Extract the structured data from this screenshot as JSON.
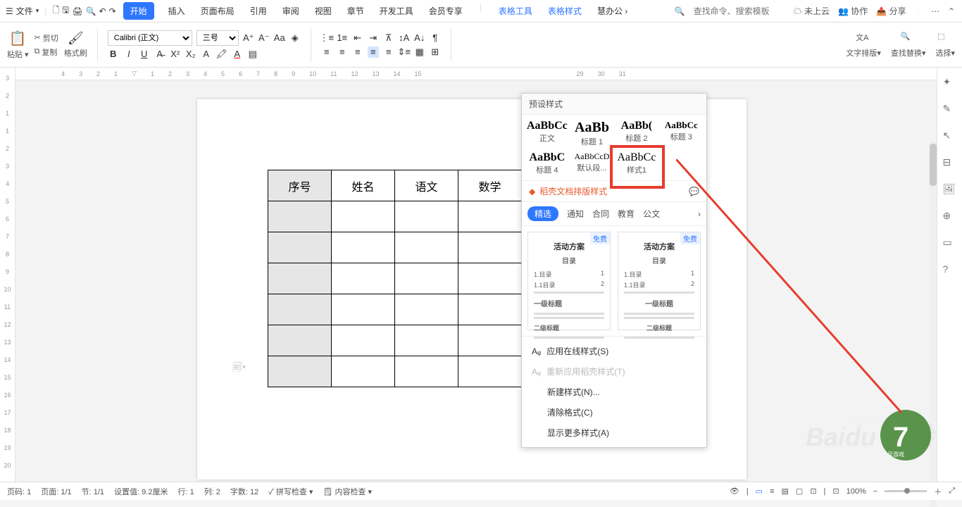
{
  "menu": {
    "file": "文件",
    "tabs": [
      "开始",
      "插入",
      "页面布局",
      "引用",
      "审阅",
      "视图",
      "章节",
      "开发工具",
      "会员专享"
    ],
    "extra": [
      "表格工具",
      "表格样式",
      "慧办公"
    ],
    "search_placeholder": "查找命令、搜索模板",
    "cloud": "未上云",
    "coop": "协作",
    "share": "分享"
  },
  "ribbon": {
    "paste": "粘贴",
    "cut": "剪切",
    "copy": "复制",
    "format_painter": "格式刷",
    "font": "Calibri (正文)",
    "size": "三号",
    "typeset": "文字排版",
    "find": "查找替换",
    "select": "选择"
  },
  "table": {
    "h1": "序号",
    "h2": "姓名",
    "h3": "语文",
    "h4": "数学"
  },
  "styles": {
    "title": "预设样式",
    "items": [
      {
        "prev": "AaBbCc",
        "lbl": "正文"
      },
      {
        "prev": "AaBb",
        "lbl": "标题 1"
      },
      {
        "prev": "AaBb(",
        "lbl": "标题 2"
      },
      {
        "prev": "AaBbCc",
        "lbl": "标题 3"
      },
      {
        "prev": "AaBbC",
        "lbl": "标题 4"
      },
      {
        "prev": "AaBbCcD",
        "lbl": "默认段..."
      },
      {
        "prev": "AaBbCc",
        "lbl": "样式1"
      }
    ],
    "doke": "稻壳文档排版样式",
    "filters": [
      "精选",
      "通知",
      "合同",
      "教育",
      "公文"
    ],
    "tmpl": {
      "free": "免费",
      "title": "活动方案",
      "sub": "目录",
      "l1": "1.目录",
      "n1": "1",
      "l2": "1.1目录",
      "n2": "2",
      "h1": "一级标题",
      "h2": "二级标题"
    },
    "menu": {
      "apply": "应用在线样式(S)",
      "reapply": "重新应用稻壳样式(T)",
      "new": "新建样式(N)...",
      "clear": "清除格式(C)",
      "more": "显示更多样式(A)"
    }
  },
  "status": {
    "page_no": "页码: 1",
    "page": "页面: 1/1",
    "sec": "节: 1/1",
    "setval": "设置值: 9.2厘米",
    "row": "行: 1",
    "col": "列: 2",
    "words": "字数: 12",
    "spell": "拼写检查",
    "content": "内容检查",
    "zoom": "100%"
  },
  "ruler_h": [
    "4",
    "3",
    "2",
    "1",
    "1",
    "2",
    "3",
    "4",
    "5",
    "6",
    "7",
    "8",
    "9",
    "10",
    "11",
    "12",
    "13",
    "14",
    "15",
    "29",
    "30",
    "31"
  ],
  "ruler_v": [
    "3",
    "2",
    "1",
    "1",
    "2",
    "3",
    "4",
    "5",
    "6",
    "7",
    "8",
    "9",
    "10",
    "11",
    "12",
    "13",
    "14",
    "15",
    "16",
    "17",
    "18",
    "19",
    "20"
  ]
}
